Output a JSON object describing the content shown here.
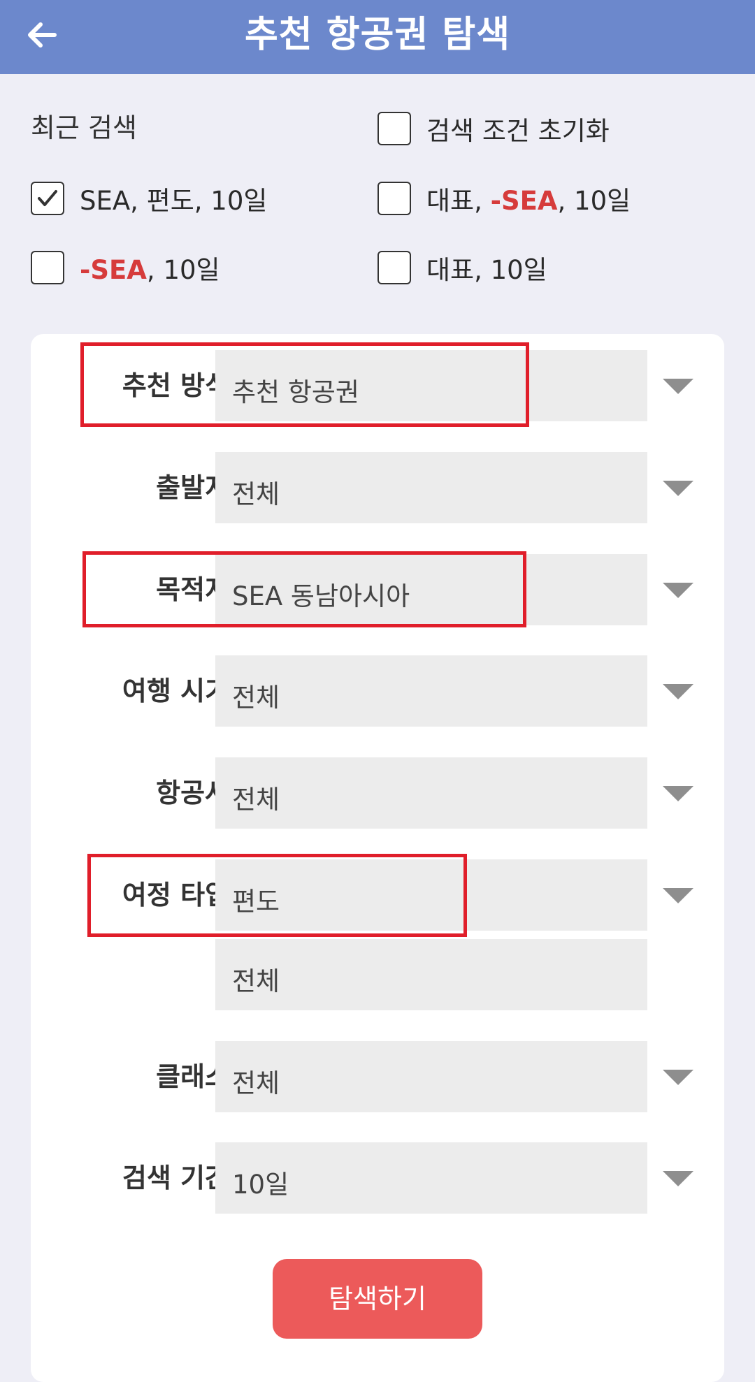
{
  "header": {
    "title": "추천 항공권 탐색",
    "back_icon": "arrow-left-icon"
  },
  "recent": {
    "label": "최근 검색",
    "reset_label": "검색 조건 초기화",
    "items": [
      {
        "checked": true,
        "parts": [
          "SEA, 편도, 10일"
        ]
      },
      {
        "checked": false,
        "parts": [
          "대표, ",
          "-SEA",
          ", 10일"
        ]
      },
      {
        "checked": false,
        "parts": [
          "-SEA",
          ", 10일"
        ]
      },
      {
        "checked": false,
        "parts": [
          "대표, 10일"
        ]
      }
    ]
  },
  "form": {
    "method": {
      "label": "추천 방식",
      "value": "추천 항공권"
    },
    "origin": {
      "label": "출발지",
      "value": "전체"
    },
    "dest": {
      "label": "목적지",
      "value": "SEA 동남아시아"
    },
    "period": {
      "label": "여행 시기",
      "value": "전체"
    },
    "airline": {
      "label": "항공사",
      "value": "전체"
    },
    "trip_type": {
      "label": "여정 타입",
      "value": "편도",
      "sub_value": "전체"
    },
    "class": {
      "label": "클래스",
      "value": "전체"
    },
    "range": {
      "label": "검색 기간",
      "value": "10일"
    }
  },
  "search_button": {
    "label": "탐색하기"
  },
  "colors": {
    "header": "#6c88cc",
    "accent_red": "#d63b3b",
    "button": "#ec5a5a",
    "highlight": "#e01e2a"
  }
}
